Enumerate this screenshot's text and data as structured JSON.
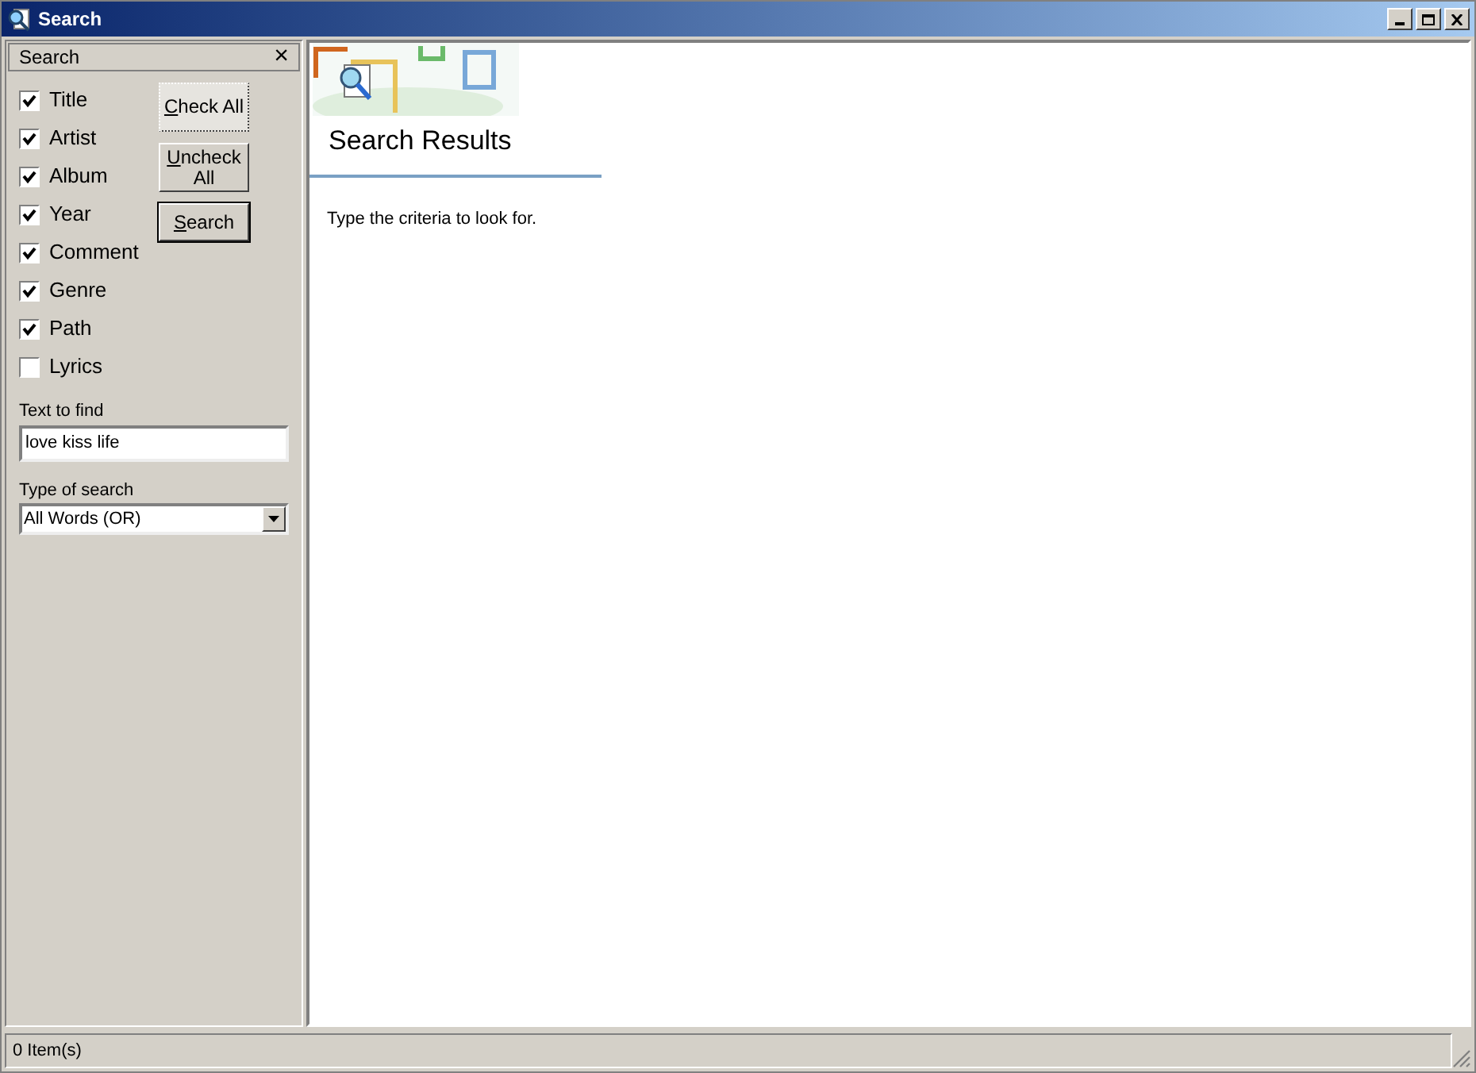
{
  "window": {
    "title": "Search"
  },
  "panel": {
    "title": "Search",
    "close": "×",
    "fields": [
      {
        "label": "Title",
        "checked": true
      },
      {
        "label": "Artist",
        "checked": true
      },
      {
        "label": "Album",
        "checked": true
      },
      {
        "label": "Year",
        "checked": true
      },
      {
        "label": "Comment",
        "checked": true
      },
      {
        "label": "Genre",
        "checked": true
      },
      {
        "label": "Path",
        "checked": true
      },
      {
        "label": "Lyrics",
        "checked": false
      }
    ],
    "buttons": [
      {
        "mnemonic": "C",
        "rest": "heck All",
        "focused": true,
        "default": false
      },
      {
        "mnemonic": "U",
        "rest": "ncheck All",
        "focused": false,
        "default": false
      },
      {
        "mnemonic": "S",
        "rest": "earch",
        "focused": false,
        "default": true
      }
    ],
    "text_to_find": {
      "label": "Text to find",
      "value": "love kiss life"
    },
    "type_of_search": {
      "label": "Type of search",
      "value": "All Words (OR)"
    }
  },
  "results": {
    "title": "Search Results",
    "message": "Type the criteria to look for."
  },
  "status_bar": "0 Item(s)"
}
